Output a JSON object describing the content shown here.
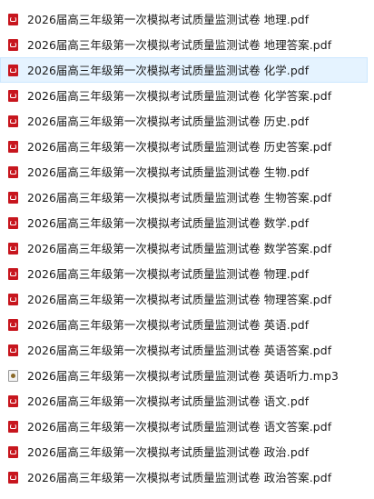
{
  "files": [
    {
      "name": "2026届高三年级第一次模拟考试质量监测试卷 地理.pdf",
      "icon": "pdf-icon",
      "selected": false
    },
    {
      "name": "2026届高三年级第一次模拟考试质量监测试卷 地理答案.pdf",
      "icon": "pdf-icon",
      "selected": false
    },
    {
      "name": "2026届高三年级第一次模拟考试质量监测试卷 化学.pdf",
      "icon": "pdf-icon",
      "selected": true
    },
    {
      "name": "2026届高三年级第一次模拟考试质量监测试卷 化学答案.pdf",
      "icon": "pdf-icon",
      "selected": false
    },
    {
      "name": "2026届高三年级第一次模拟考试质量监测试卷 历史.pdf",
      "icon": "pdf-icon",
      "selected": false
    },
    {
      "name": "2026届高三年级第一次模拟考试质量监测试卷 历史答案.pdf",
      "icon": "pdf-icon",
      "selected": false
    },
    {
      "name": "2026届高三年级第一次模拟考试质量监测试卷 生物.pdf",
      "icon": "pdf-icon",
      "selected": false
    },
    {
      "name": "2026届高三年级第一次模拟考试质量监测试卷 生物答案.pdf",
      "icon": "pdf-icon",
      "selected": false
    },
    {
      "name": "2026届高三年级第一次模拟考试质量监测试卷 数学.pdf",
      "icon": "pdf-icon",
      "selected": false
    },
    {
      "name": "2026届高三年级第一次模拟考试质量监测试卷 数学答案.pdf",
      "icon": "pdf-icon",
      "selected": false
    },
    {
      "name": "2026届高三年级第一次模拟考试质量监测试卷 物理.pdf",
      "icon": "pdf-icon",
      "selected": false
    },
    {
      "name": "2026届高三年级第一次模拟考试质量监测试卷 物理答案.pdf",
      "icon": "pdf-icon",
      "selected": false
    },
    {
      "name": "2026届高三年级第一次模拟考试质量监测试卷 英语.pdf",
      "icon": "pdf-icon",
      "selected": false
    },
    {
      "name": "2026届高三年级第一次模拟考试质量监测试卷 英语答案.pdf",
      "icon": "pdf-icon",
      "selected": false
    },
    {
      "name": "2026届高三年级第一次模拟考试质量监测试卷 英语听力.mp3",
      "icon": "audio-file-icon",
      "selected": false
    },
    {
      "name": "2026届高三年级第一次模拟考试质量监测试卷 语文.pdf",
      "icon": "pdf-icon",
      "selected": false
    },
    {
      "name": "2026届高三年级第一次模拟考试质量监测试卷 语文答案.pdf",
      "icon": "pdf-icon",
      "selected": false
    },
    {
      "name": "2026届高三年级第一次模拟考试质量监测试卷 政治.pdf",
      "icon": "pdf-icon",
      "selected": false
    },
    {
      "name": "2026届高三年级第一次模拟考试质量监测试卷 政治答案.pdf",
      "icon": "pdf-icon",
      "selected": false
    }
  ],
  "colors": {
    "selection_background": "#e5f3ff",
    "selection_border": "#cce8ff",
    "pdf_icon": "#c7161e"
  }
}
